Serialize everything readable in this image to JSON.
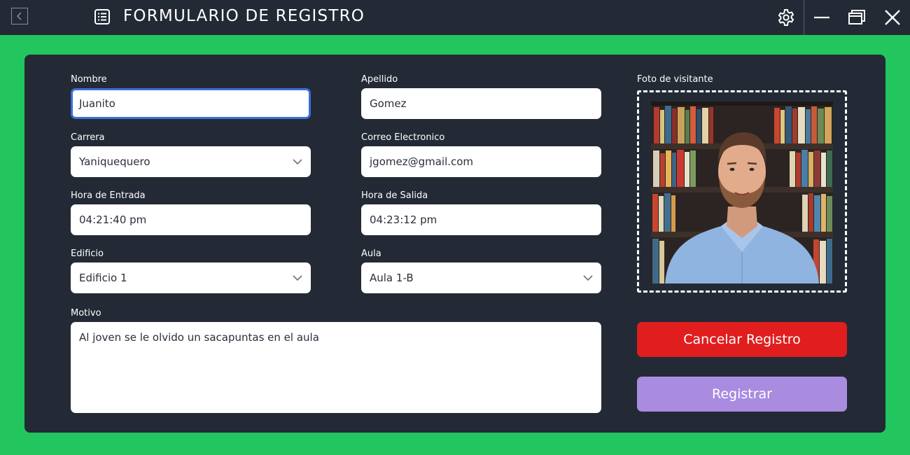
{
  "window": {
    "title": "FORMULARIO DE REGISTRO",
    "icons": {
      "back": "back-arrow-icon",
      "form": "form-list-icon",
      "settings": "gear-icon",
      "minimize": "minimize-icon",
      "maximize": "restore-icon",
      "close": "close-icon"
    }
  },
  "form": {
    "nombre": {
      "label": "Nombre",
      "value": "Juanito"
    },
    "apellido": {
      "label": "Apellido",
      "value": "Gomez"
    },
    "carrera": {
      "label": "Carrera",
      "value": "Yaniquequero"
    },
    "correo": {
      "label": "Correo Electronico",
      "value": "jgomez@gmail.com"
    },
    "hora_entrada": {
      "label": "Hora de Entrada",
      "value": "04:21:40 pm"
    },
    "hora_salida": {
      "label": "Hora de Salida",
      "value": "04:23:12 pm"
    },
    "edificio": {
      "label": "Edificio",
      "value": "Edificio 1"
    },
    "aula": {
      "label": "Aula",
      "value": "Aula 1-B"
    },
    "motivo": {
      "label": "Motivo",
      "value": "Al joven se le olvido un sacapuntas en el aula"
    }
  },
  "photo": {
    "label": "Foto de visitante"
  },
  "actions": {
    "cancel_label": "Cancelar Registro",
    "register_label": "Registrar"
  },
  "colors": {
    "background": "#22c55e",
    "panel": "#232a35",
    "cancel": "#e01e1e",
    "register": "#a98be0",
    "focus": "#3b6fd8"
  }
}
